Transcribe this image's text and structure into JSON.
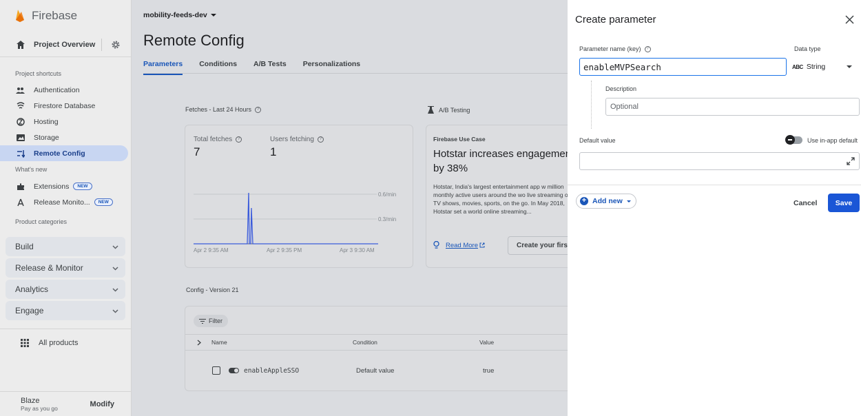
{
  "sidebar": {
    "brand": "Firebase",
    "project_overview": "Project Overview",
    "shortcuts_label": "Project shortcuts",
    "shortcuts": [
      {
        "label": "Authentication",
        "icon": "people-icon"
      },
      {
        "label": "Firestore Database",
        "icon": "firestore-icon"
      },
      {
        "label": "Hosting",
        "icon": "hosting-icon"
      },
      {
        "label": "Storage",
        "icon": "storage-icon"
      },
      {
        "label": "Remote Config",
        "icon": "remote-config-icon",
        "active": true
      }
    ],
    "whats_new_label": "What's new",
    "whats_new": [
      {
        "label": "Extensions",
        "badge": "NEW",
        "icon": "extensions-icon"
      },
      {
        "label": "Release Monito...",
        "badge": "NEW",
        "icon": "release-monitor-icon"
      }
    ],
    "categories_label": "Product categories",
    "categories": [
      "Build",
      "Release & Monitor",
      "Analytics",
      "Engage"
    ],
    "all_products": "All products",
    "plan": {
      "name": "Blaze",
      "subtitle": "Pay as you go",
      "action": "Modify"
    }
  },
  "main": {
    "project": "mobility-feeds-dev",
    "title": "Remote Config",
    "tabs": [
      "Parameters",
      "Conditions",
      "A/B Tests",
      "Personalizations"
    ],
    "active_tab": "Parameters",
    "fetches": {
      "header": "Fetches - Last 24 Hours",
      "total_label": "Total fetches",
      "total_value": "7",
      "users_label": "Users fetching",
      "users_value": "1",
      "rate_high": "0.6/min",
      "rate_low": "0.3/min",
      "x_labels": [
        "Apr 2 9:35 AM",
        "Apr 2 9:35 PM",
        "Apr 3 9:30 AM"
      ]
    },
    "ab": {
      "header": "A/B Testing",
      "case_label": "Firebase Use Case",
      "case_title": "Hotstar increases engagemen by 38%",
      "case_body": "Hotstar, India's largest entertainment app w million monthly active users around the wo live streaming of TV shows, movies, sports, on the go. In May 2018, Hotstar set a world online streaming...",
      "read_more": "Read More",
      "create_btn": "Create your first"
    },
    "config": {
      "header": "Config - Version 21",
      "filter": "Filter",
      "columns": [
        "Name",
        "Condition",
        "Value"
      ],
      "rows": [
        {
          "name": "enableAppleSSO",
          "condition": "Default value",
          "value": "true"
        }
      ]
    }
  },
  "panel": {
    "title": "Create parameter",
    "key_label": "Parameter name (key)",
    "key_value": "enableMVPSearch",
    "data_type_label": "Data type",
    "data_type_icon": "ABC",
    "data_type_value": "String",
    "desc_label": "Description",
    "desc_placeholder": "Optional",
    "default_label": "Default value",
    "in_app_label": "Use in-app default",
    "add_new": "Add new",
    "cancel": "Cancel",
    "save": "Save"
  },
  "colors": {
    "accent": "#1a56d6",
    "active_nav": "#c8d6f2",
    "chart_line": "#3b5bdb"
  }
}
